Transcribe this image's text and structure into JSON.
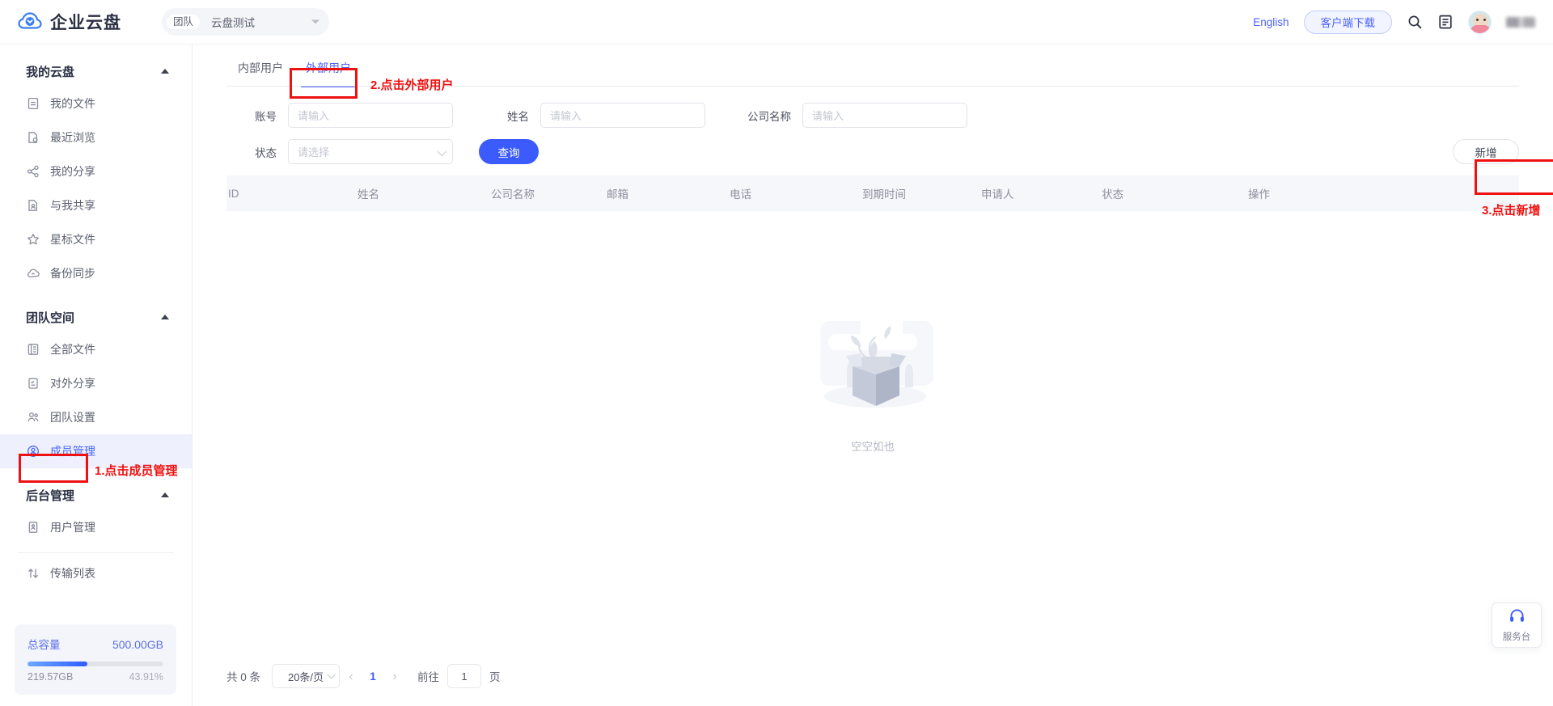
{
  "header": {
    "brand": "企业云盘",
    "logo_icon": "cloud-icon",
    "team_label": "团队",
    "team_value": "云盘测试",
    "team_caret_icon": "chevron-down-icon",
    "language_link": "English",
    "client_download": "客户端下载",
    "search_icon": "search-icon",
    "notes_icon": "notes-icon",
    "avatar_icon": "avatar",
    "accent_color": "#4a63ff"
  },
  "sidebar": {
    "groups": [
      {
        "title": "我的云盘",
        "collapse_icon": "chevron-up-icon",
        "items": [
          {
            "label": "我的文件",
            "icon": "file-icon",
            "active": false
          },
          {
            "label": "最近浏览",
            "icon": "recent-file-icon",
            "active": false
          },
          {
            "label": "我的分享",
            "icon": "share-icon",
            "active": false
          },
          {
            "label": "与我共享",
            "icon": "shared-with-me-icon",
            "active": false
          },
          {
            "label": "星标文件",
            "icon": "star-icon",
            "active": false
          },
          {
            "label": "备份同步",
            "icon": "cloud-sync-icon",
            "active": false
          }
        ]
      },
      {
        "title": "团队空间",
        "collapse_icon": "chevron-up-icon",
        "items": [
          {
            "label": "全部文件",
            "icon": "list-icon",
            "active": false
          },
          {
            "label": "对外分享",
            "icon": "external-share-icon",
            "active": false
          },
          {
            "label": "团队设置",
            "icon": "users-icon",
            "active": false
          },
          {
            "label": "成员管理",
            "icon": "user-circle-icon",
            "active": true
          }
        ]
      },
      {
        "title": "后台管理",
        "collapse_icon": "chevron-up-icon",
        "items": [
          {
            "label": "用户管理",
            "icon": "id-card-icon",
            "active": false
          }
        ]
      }
    ],
    "transfer": {
      "label": "传输列表",
      "icon": "transfer-icon"
    },
    "quota": {
      "label": "总容量",
      "total": "500.00GB",
      "used": "219.57GB",
      "percent_text": "43.91%",
      "percent_value": 43.91,
      "fill_color": "#2f5bff"
    }
  },
  "main": {
    "tabs": [
      {
        "label": "内部用户",
        "active": false
      },
      {
        "label": "外部用户",
        "active": true
      }
    ],
    "filters": {
      "account": {
        "label": "账号",
        "placeholder": "请输入",
        "value": ""
      },
      "name": {
        "label": "姓名",
        "placeholder": "请输入",
        "value": ""
      },
      "company": {
        "label": "公司名称",
        "placeholder": "请输入",
        "value": ""
      },
      "status": {
        "label": "状态",
        "placeholder": "请选择",
        "value": ""
      },
      "query_button": "查询",
      "add_button": "新增"
    },
    "table": {
      "columns": [
        "ID",
        "姓名",
        "公司名称",
        "邮箱",
        "电话",
        "到期时间",
        "申请人",
        "状态",
        "操作"
      ],
      "rows": [],
      "empty_text": "空空如也",
      "empty_icon": "empty-box-illustration"
    },
    "pagination": {
      "total_text": "共 0 条",
      "page_size": "20条/页",
      "prev_icon": "chevron-left-icon",
      "next_icon": "chevron-right-icon",
      "current_page": "1",
      "goto_label": "前往",
      "goto_value": "1",
      "page_unit": "页"
    }
  },
  "service_widget": {
    "label": "服务台",
    "icon": "headset-icon"
  },
  "annotations": [
    {
      "id": "step1",
      "text": "1.点击成员管理"
    },
    {
      "id": "step2",
      "text": "2.点击外部用户"
    },
    {
      "id": "step3",
      "text": "3.点击新增"
    }
  ]
}
